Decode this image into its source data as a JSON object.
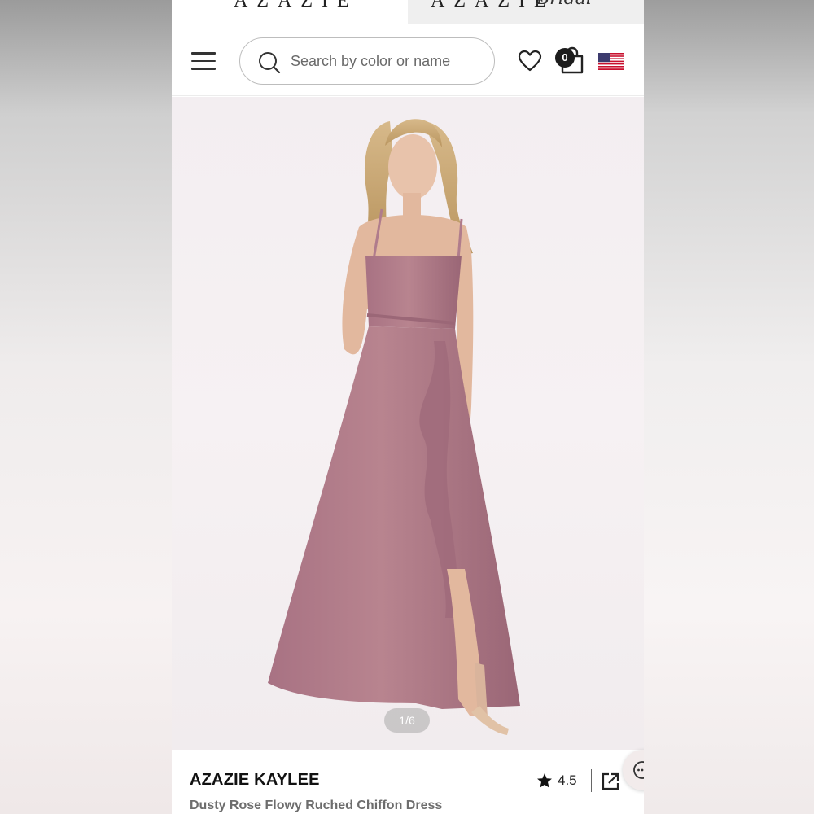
{
  "brand": {
    "main_tab": "AZAZIE",
    "bridal_tab": "AZAZIE",
    "bridal_script": "Bridal"
  },
  "header": {
    "search_placeholder": "Search by color or name",
    "cart_count": "0",
    "icons": [
      "menu-icon",
      "search-icon",
      "heart-icon",
      "bag-icon",
      "us-flag-icon"
    ]
  },
  "gallery": {
    "counter": "1/6"
  },
  "product": {
    "name": "AZAZIE KAYLEE",
    "subtitle": "Dusty Rose Flowy Ruched Chiffon Dress",
    "rating": "4.5"
  },
  "colors": {
    "dress": "#b07c8c",
    "background": "#f3eef1"
  }
}
